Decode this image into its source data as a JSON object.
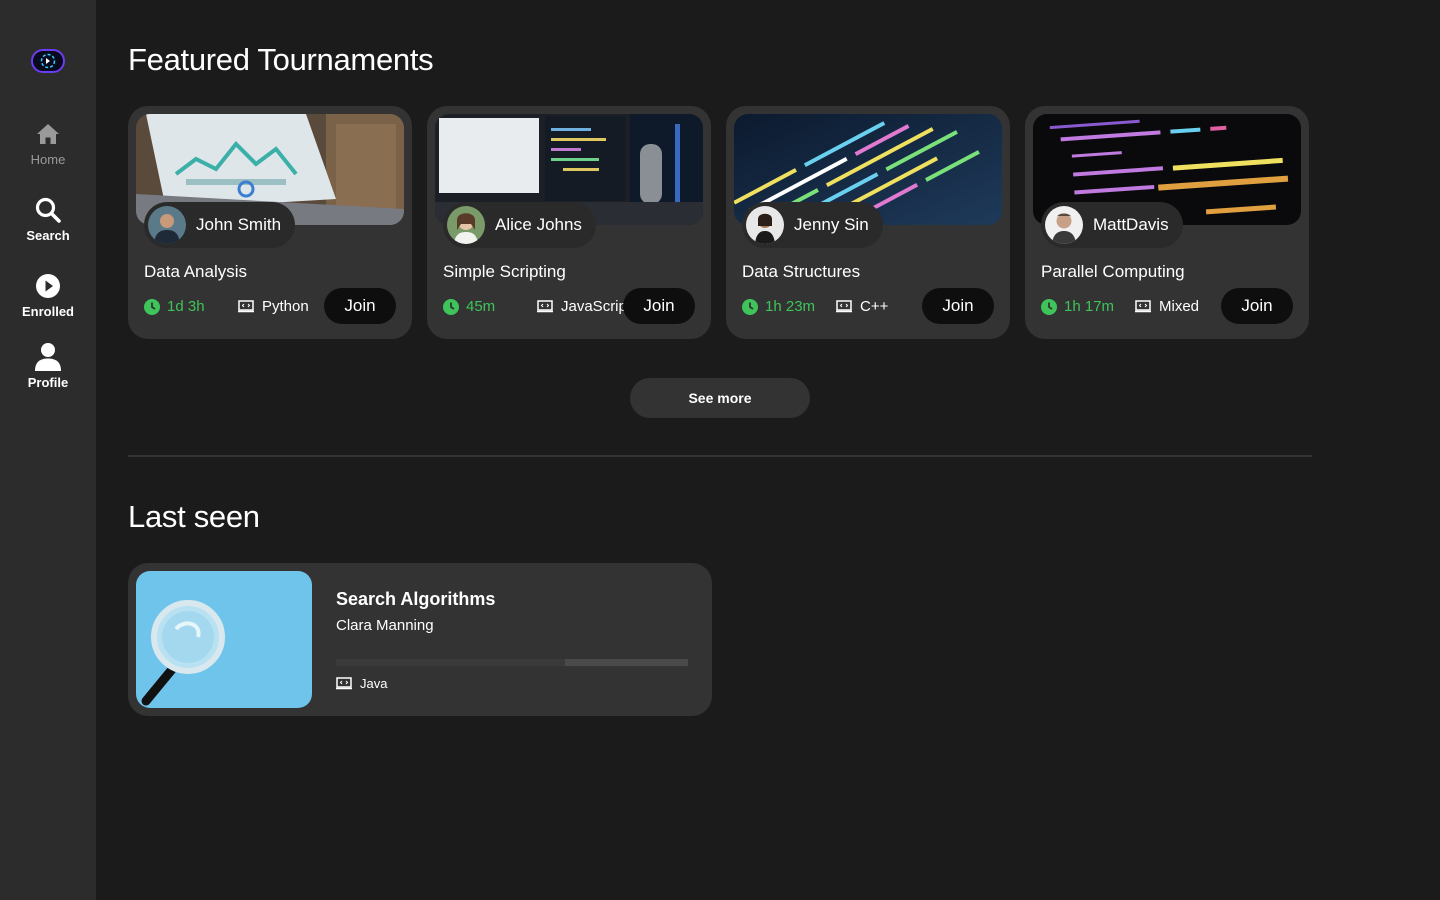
{
  "sidebar": {
    "items": [
      {
        "label": "Home",
        "icon": "home-icon"
      },
      {
        "label": "Search",
        "icon": "search-icon"
      },
      {
        "label": "Enrolled",
        "icon": "play-circle-icon"
      },
      {
        "label": "Profile",
        "icon": "person-icon"
      }
    ]
  },
  "featured": {
    "title": "Featured Tournaments",
    "cards": [
      {
        "host": "John Smith",
        "title": "Data Analysis",
        "time": "1d 3h",
        "language": "Python",
        "join_label": "Join"
      },
      {
        "host": "Alice Johns",
        "title": "Simple Scripting",
        "time": "45m",
        "language": "JavaScript",
        "join_label": "Join"
      },
      {
        "host": "Jenny Sin",
        "title": "Data Structures",
        "time": "1h 23m",
        "language": "C++",
        "join_label": "Join"
      },
      {
        "host": "MattDavis",
        "title": "Parallel Computing",
        "time": "1h 17m",
        "language": "Mixed",
        "join_label": "Join"
      }
    ],
    "see_more_label": "See more"
  },
  "last_seen": {
    "title": "Last seen",
    "item": {
      "title": "Search Algorithms",
      "author": "Clara Manning",
      "language": "Java",
      "progress": 0.35
    }
  },
  "colors": {
    "background": "#1b1b1b",
    "sidebar": "#2c2c2c",
    "card": "#333333",
    "accent_green": "#3ec45a",
    "button": "#0e0e0e"
  }
}
